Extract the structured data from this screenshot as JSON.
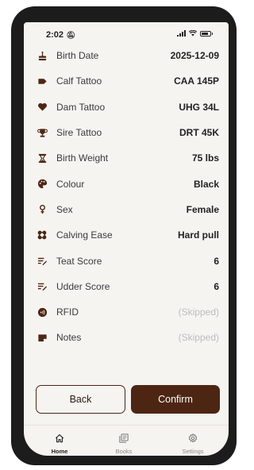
{
  "status_bar": {
    "time": "2:02",
    "notification_icon": "bell-off-icon",
    "signal_icon": "signal-icon",
    "wifi_icon": "wifi-icon",
    "battery_icon": "battery-icon"
  },
  "fields": [
    {
      "icon": "cake-icon",
      "label": "Birth Date",
      "value": "2025-12-09",
      "skipped": false
    },
    {
      "icon": "tag-icon",
      "label": "Calf Tattoo",
      "value": "CAA 145P",
      "skipped": false
    },
    {
      "icon": "heart-icon",
      "label": "Dam Tattoo",
      "value": "UHG 34L",
      "skipped": false
    },
    {
      "icon": "trophy-icon",
      "label": "Sire Tattoo",
      "value": "DRT 45K",
      "skipped": false
    },
    {
      "icon": "scale-icon",
      "label": "Birth Weight",
      "value": "75 lbs",
      "skipped": false
    },
    {
      "icon": "palette-icon",
      "label": "Colour",
      "value": "Black",
      "skipped": false
    },
    {
      "icon": "female-icon",
      "label": "Sex",
      "value": "Female",
      "skipped": false
    },
    {
      "icon": "bandage-icon",
      "label": "Calving Ease",
      "value": "Hard pull",
      "skipped": false
    },
    {
      "icon": "score-icon",
      "label": "Teat Score",
      "value": "6",
      "skipped": false
    },
    {
      "icon": "score-icon",
      "label": "Udder Score",
      "value": "6",
      "skipped": false
    },
    {
      "icon": "rfid-icon",
      "label": "RFID",
      "value": "(Skipped)",
      "skipped": true
    },
    {
      "icon": "note-icon",
      "label": "Notes",
      "value": "(Skipped)",
      "skipped": true
    }
  ],
  "actions": {
    "back_label": "Back",
    "confirm_label": "Confirm"
  },
  "tabs": [
    {
      "icon": "home-icon",
      "label": "Home",
      "active": true
    },
    {
      "icon": "books-icon",
      "label": "Books",
      "active": false
    },
    {
      "icon": "settings-icon",
      "label": "Settings",
      "active": false
    }
  ],
  "colors": {
    "accent": "#4d2613",
    "background": "#f6f4f1",
    "skipped_text": "#bdbdbd"
  }
}
